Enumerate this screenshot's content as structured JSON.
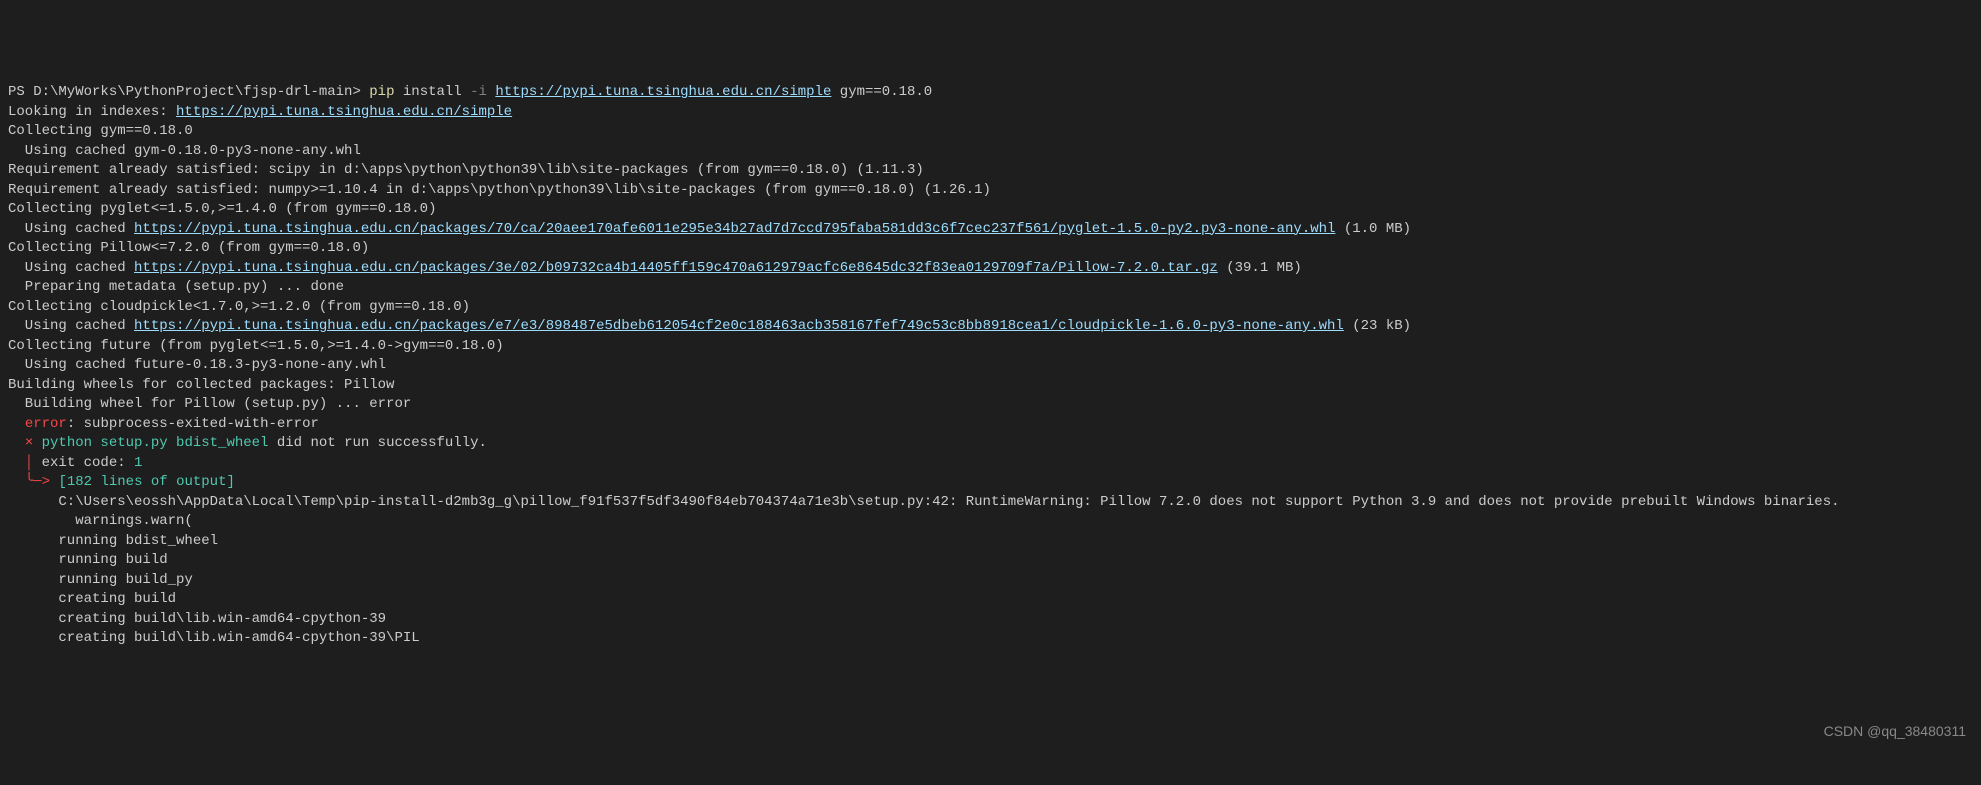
{
  "prompt": {
    "prefix": "PS D:\\MyWorks\\PythonProject\\fjsp-drl-main> ",
    "cmd": "pip",
    "arg1": " install ",
    "flag": "-i",
    "space": " ",
    "url": "https://pypi.tuna.tsinghua.edu.cn/simple",
    "suffix": " gym==0.18.0"
  },
  "lines": {
    "l2a": "Looking in indexes: ",
    "l2b": "https://pypi.tuna.tsinghua.edu.cn/simple",
    "l3": "Collecting gym==0.18.0",
    "l4": "  Using cached gym-0.18.0-py3-none-any.whl",
    "l5": "Requirement already satisfied: scipy in d:\\apps\\python\\python39\\lib\\site-packages (from gym==0.18.0) (1.11.3)",
    "l6": "Requirement already satisfied: numpy>=1.10.4 in d:\\apps\\python\\python39\\lib\\site-packages (from gym==0.18.0) (1.26.1)",
    "l7": "Collecting pyglet<=1.5.0,>=1.4.0 (from gym==0.18.0)",
    "l8a": "  Using cached ",
    "l8b": "https://pypi.tuna.tsinghua.edu.cn/packages/70/ca/20aee170afe6011e295e34b27ad7d7ccd795faba581dd3c6f7cec237f561/pyglet-1.5.0-py2.py3-none-any.whl",
    "l8c": " (1.0 MB)",
    "l9": "Collecting Pillow<=7.2.0 (from gym==0.18.0)",
    "l10a": "  Using cached ",
    "l10b": "https://pypi.tuna.tsinghua.edu.cn/packages/3e/02/b09732ca4b14405ff159c470a612979acfc6e8645dc32f83ea0129709f7a/Pillow-7.2.0.tar.gz",
    "l10c": " (39.1 MB)",
    "l11": "  Preparing metadata (setup.py) ... done",
    "l12": "Collecting cloudpickle<1.7.0,>=1.2.0 (from gym==0.18.0)",
    "l13a": "  Using cached ",
    "l13b": "https://pypi.tuna.tsinghua.edu.cn/packages/e7/e3/898487e5dbeb612054cf2e0c188463acb358167fef749c53c8bb8918cea1/cloudpickle-1.6.0-py3-none-any.whl",
    "l13c": " (23 kB)",
    "l14": "Collecting future (from pyglet<=1.5.0,>=1.4.0->gym==0.18.0)",
    "l15": "  Using cached future-0.18.3-py3-none-any.whl",
    "l16": "Building wheels for collected packages: Pillow",
    "l17": "  Building wheel for Pillow (setup.py) ... error",
    "l18a": "  ",
    "l18b": "error",
    "l18c": ": ",
    "l18d": "subprocess-exited-with-error",
    "l19": "",
    "l20a": "  ",
    "l20b": "×",
    "l20c": " ",
    "l20d": "python setup.py bdist_wheel",
    "l20e": " did not run successfully.",
    "l21a": "  ",
    "l21b": "│",
    "l21c": " exit code: ",
    "l21d": "1",
    "l22a": "  ",
    "l22b": "╰─>",
    "l22c": " ",
    "l22d": "[182 lines of output]",
    "l23": "      C:\\Users\\eossh\\AppData\\Local\\Temp\\pip-install-d2mb3g_g\\pillow_f91f537f5df3490f84eb704374a71e3b\\setup.py:42: RuntimeWarning: Pillow 7.2.0 does not support Python 3.9 and does not provide prebuilt Windows binaries. ",
    "l24": "        warnings.warn(",
    "l25": "      running bdist_wheel",
    "l26": "      running build",
    "l27": "      running build_py",
    "l28": "      creating build",
    "l29": "      creating build\\lib.win-amd64-cpython-39",
    "l30": "      creating build\\lib.win-amd64-cpython-39\\PIL"
  },
  "watermark": "CSDN @qq_38480311"
}
